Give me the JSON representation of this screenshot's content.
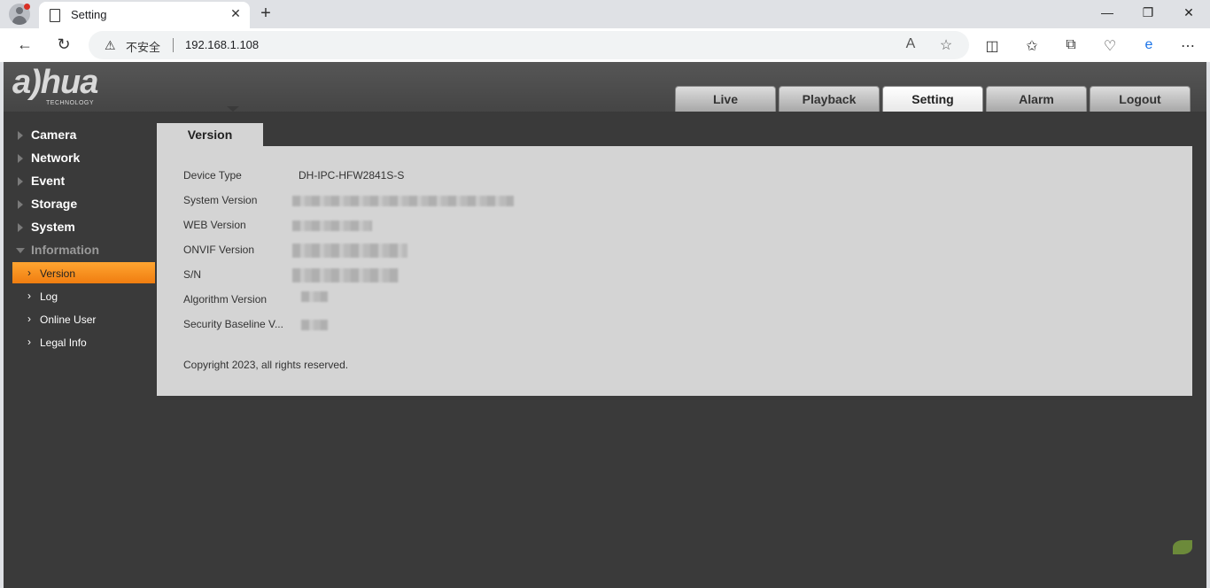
{
  "browser": {
    "tab_title": "Setting",
    "tab_close": "✕",
    "new_tab": "+",
    "address": {
      "security_label": "不安全",
      "url": "192.168.1.108"
    },
    "window_controls": {
      "minimize": "—",
      "restore": "❐",
      "close": "✕"
    },
    "nav": {
      "back": "←",
      "reload": "↻"
    }
  },
  "app": {
    "logo_text": "a)hua",
    "logo_sub": "TECHNOLOGY",
    "main_tabs": [
      {
        "label": "Live"
      },
      {
        "label": "Playback"
      },
      {
        "label": "Setting",
        "active": true
      },
      {
        "label": "Alarm"
      },
      {
        "label": "Logout"
      }
    ],
    "sidebar": {
      "groups": [
        {
          "label": "Camera"
        },
        {
          "label": "Network"
        },
        {
          "label": "Event"
        },
        {
          "label": "Storage"
        },
        {
          "label": "System"
        },
        {
          "label": "Information",
          "open": true
        }
      ],
      "sub_items": [
        {
          "label": "Version",
          "active": true
        },
        {
          "label": "Log"
        },
        {
          "label": "Online User"
        },
        {
          "label": "Legal Info"
        }
      ]
    },
    "content": {
      "tab_label": "Version",
      "rows": [
        {
          "key": "Device Type",
          "value": "DH-IPC-HFW2841S-S"
        },
        {
          "key": "System Version",
          "value": ""
        },
        {
          "key": "WEB Version",
          "value": ""
        },
        {
          "key": "ONVIF Version",
          "value": ""
        },
        {
          "key": "S/N",
          "value": ""
        },
        {
          "key": "Algorithm Version",
          "value": ""
        },
        {
          "key": "Security Baseline V...",
          "value": ""
        }
      ],
      "copyright": "Copyright 2023, all rights reserved."
    }
  },
  "colors": {
    "accent_orange": "#f39320",
    "app_bg": "#3a3a3a",
    "panel_bg": "#d4d4d4"
  }
}
